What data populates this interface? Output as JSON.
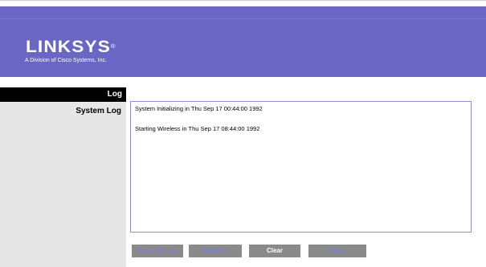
{
  "header": {
    "logo_text": "LINKSYS",
    "logo_reg": "®",
    "tagline": "A Division of Cisco Systems, Inc."
  },
  "sidebar": {
    "section_label": "Log",
    "item_label": "System Log"
  },
  "log": {
    "lines": [
      "System Initializing in Thu Sep 17 00:44:00 1992",
      "Starting Wireless in Thu Sep 17 08:44:00 1992"
    ]
  },
  "buttons": {
    "save": "Save the Log",
    "refresh": "Refresh",
    "clear": "Clear",
    "close": "Close"
  },
  "colors": {
    "header": "#6a66c3",
    "sidebar": "#e6e6e6",
    "section_bar": "#000000",
    "button_bg": "#8a8a8a",
    "button_text": "#7b7fd0",
    "logbox_border": "#8d8bd1"
  }
}
